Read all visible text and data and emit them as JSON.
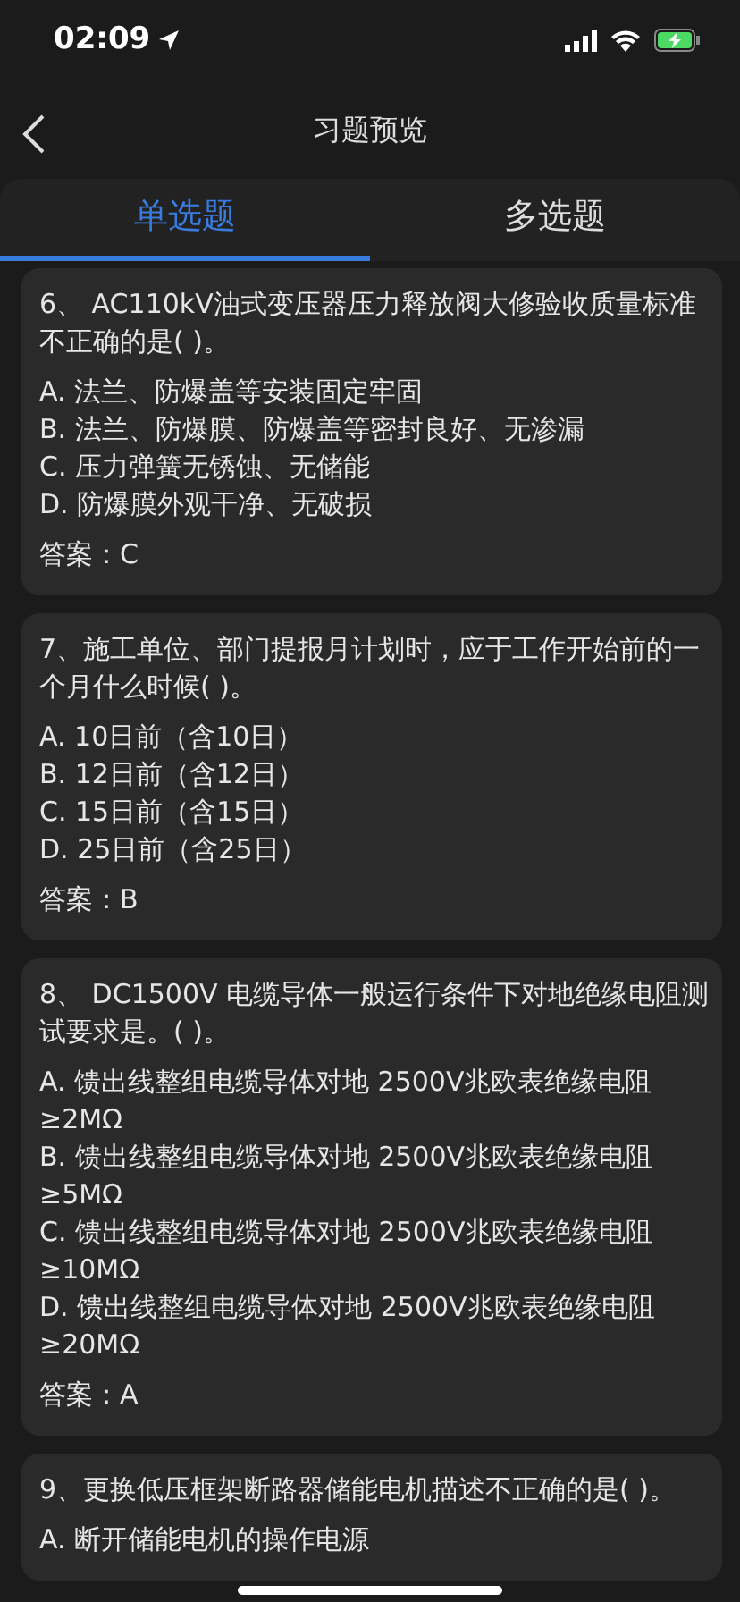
{
  "status_bar": {
    "time": "02:09"
  },
  "header": {
    "title": "习题预览"
  },
  "tabs": [
    {
      "label": "单选题",
      "selected": true
    },
    {
      "label": "多选题",
      "selected": false
    }
  ],
  "questions": [
    {
      "question": "6、 AC110kV油式变压器压力释放阀大修验收质量标准不正确的是(   )。",
      "options": [
        "A. 法兰、防爆盖等安装固定牢固",
        "B. 法兰、防爆膜、防爆盖等密封良好、无渗漏",
        "C. 压力弹簧无锈蚀、无储能",
        "D. 防爆膜外观干净、无破损"
      ],
      "answer": "答案：C"
    },
    {
      "question": "7、施工单位、部门提报月计划时，应于工作开始前的一个月什么时候(   )。",
      "options": [
        "A. 10日前（含10日）",
        "B. 12日前（含12日）",
        "C. 15日前（含15日）",
        "D. 25日前（含25日）"
      ],
      "answer": "答案：B"
    },
    {
      "question": "8、 DC1500V 电缆导体一般运行条件下对地绝缘电阻测试要求是。(   )。",
      "options": [
        "A. 馈出线整组电缆导体对地 2500V兆欧表绝缘电阻≥2MΩ",
        "B. 馈出线整组电缆导体对地 2500V兆欧表绝缘电阻≥5MΩ",
        "C. 馈出线整组电缆导体对地 2500V兆欧表绝缘电阻≥10MΩ",
        "D. 馈出线整组电缆导体对地 2500V兆欧表绝缘电阻≥20MΩ"
      ],
      "answer": "答案：A"
    },
    {
      "question": "9、更换低压框架断路器储能电机描述不正确的是(   )。",
      "options": [
        "A. 断开储能电机的操作电源"
      ]
    }
  ]
}
